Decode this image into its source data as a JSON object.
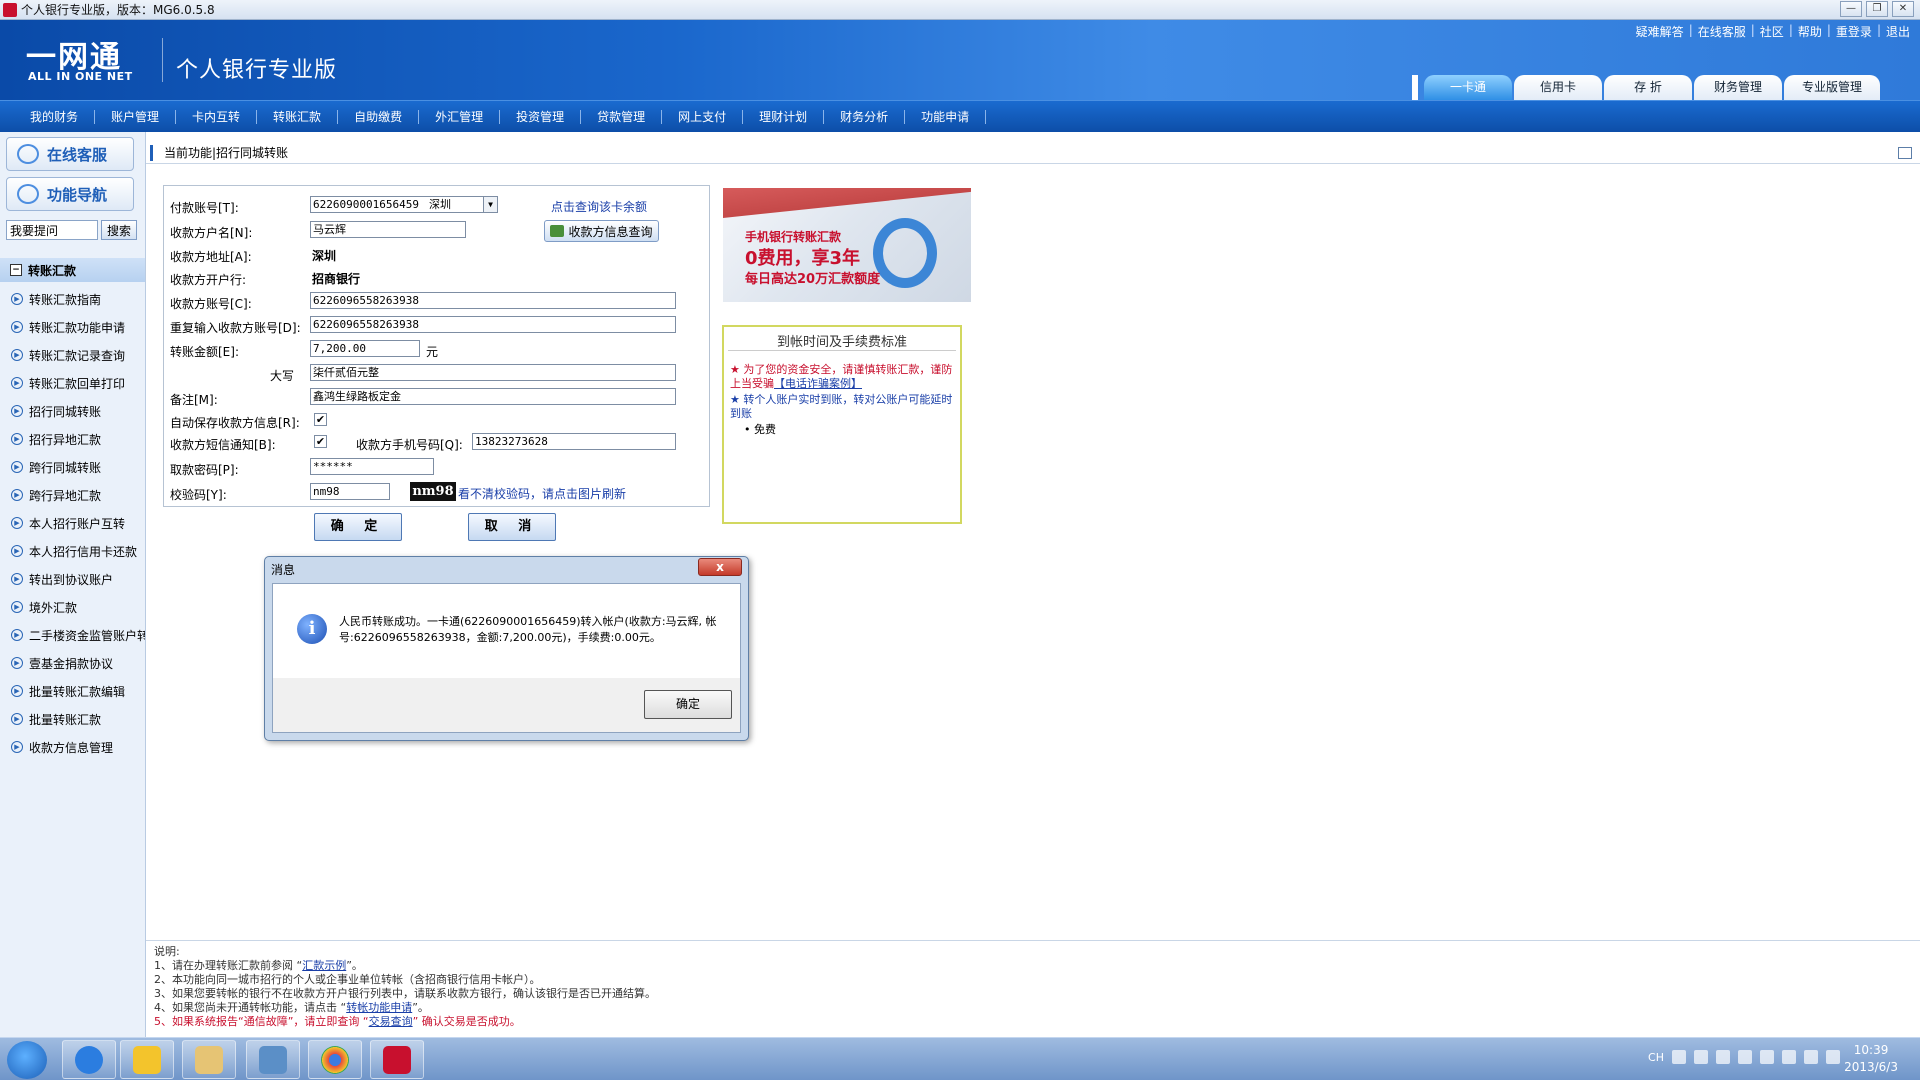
{
  "window": {
    "title": "个人银行专业版，版本：MG6.0.5.8",
    "controls": [
      "—",
      "❐",
      "✕"
    ]
  },
  "header": {
    "logo_main": "一网通",
    "logo_sub": "ALL IN ONE NET",
    "product_name": "个人银行专业版",
    "top_links": [
      "疑难解答",
      "在线客服",
      "社区",
      "帮助",
      "重登录",
      "退出"
    ],
    "tabs": [
      {
        "label": "一卡通",
        "active": true
      },
      {
        "label": "信用卡",
        "active": false
      },
      {
        "label": "存 折",
        "active": false
      },
      {
        "label": "财务管理",
        "active": false
      },
      {
        "label": "专业版管理",
        "active": false
      }
    ]
  },
  "nav": [
    "我的财务",
    "账户管理",
    "卡内互转",
    "转账汇款",
    "自助缴费",
    "外汇管理",
    "投资管理",
    "贷款管理",
    "网上支付",
    "理财计划",
    "财务分析",
    "功能申请"
  ],
  "sidebar": {
    "online_service": "在线客服",
    "function_nav": "功能导航",
    "search_placeholder": "我要提问",
    "search_button": "搜索",
    "section_title": "转账汇款",
    "items": [
      "转账汇款指南",
      "转账汇款功能申请",
      "转账汇款记录查询",
      "转账汇款回单打印",
      "招行同城转账",
      "招行异地汇款",
      "跨行同城转账",
      "跨行异地汇款",
      "本人招行账户互转",
      "本人招行信用卡还款",
      "转出到协议账户",
      "境外汇款",
      "二手楼资金监管账户转",
      "壹基金捐款协议",
      "批量转账汇款编辑",
      "批量转账汇款",
      "收款方信息管理"
    ]
  },
  "content": {
    "breadcrumb": "当前功能|招行同城转账",
    "form": {
      "payer_account_label": "付款账号[T]:",
      "payer_account_value": "6226090001656459",
      "payer_city": "深圳",
      "balance_link": "点击查询该卡余额",
      "payee_name_label": "收款方户名[N]:",
      "payee_name_value": "马云辉",
      "payee_info_button": "收款方信息查询",
      "payee_address_label": "收款方地址[A]:",
      "payee_address_value": "深圳",
      "payee_bank_label": "收款方开户行:",
      "payee_bank_value": "招商银行",
      "payee_account_label": "收款方账号[C]:",
      "payee_account_value": "6226096558263938",
      "payee_account_repeat_label": "重复输入收款方账号[D]:",
      "payee_account_repeat_value": "6226096558263938",
      "amount_label": "转账金额[E]:",
      "amount_value": "7,200.00",
      "amount_unit": "元",
      "uppercase_label": "大写",
      "uppercase_value": "柒仟贰佰元整",
      "remark_label": "备注[M]:",
      "remark_value": "鑫鸿生绿路板定金",
      "auto_save_label": "自动保存收款方信息[R]:",
      "auto_save_checked": "✔",
      "sms_label": "收款方短信通知[B]:",
      "sms_checked": "✔",
      "mobile_label": "收款方手机号码[Q]:",
      "mobile_value": "13823273628",
      "withdraw_pwd_label": "取款密码[P]:",
      "withdraw_pwd_value": "******",
      "captcha_label": "校验码[Y]:",
      "captcha_input": "nm98",
      "captcha_image_text": "nm98",
      "captcha_hint": "看不清校验码，请点击图片刷新",
      "confirm_button": "确 定",
      "cancel_button": "取 消"
    },
    "banner": {
      "line1": "手机银行转账汇款",
      "line2": "0费用，享3年",
      "line3": "每日高达20万汇款额度"
    },
    "notice": {
      "title": "到帐时间及手续费标准",
      "line1_star": "★",
      "line1": "为了您的资金安全，请谨慎转账汇款，谨防上当受骗",
      "line1_link": "【电话诈骗案例】",
      "line2_star": "★",
      "line2": "转个人账户实时到账，转对公账户可能延时到账",
      "line3": "免费"
    },
    "instructions": {
      "title": "说明:",
      "l1_a": "1、请在办理转账汇款前参阅 “",
      "l1_link": "汇款示例",
      "l1_b": "”。",
      "l2": "2、本功能向同一城市招行的个人或企事业单位转帐（含招商银行信用卡帐户）。",
      "l3": "3、如果您要转帐的银行不在收款方开户银行列表中，请联系收款方银行，确认该银行是否已开通结算。",
      "l4_a": "4、如果您尚未开通转帐功能，请点击 “",
      "l4_link": "转帐功能申请",
      "l4_b": "”。",
      "l5_a": "5、如果系统报告“通信故障”，请立即查询 “",
      "l5_link": "交易查询",
      "l5_b": "” 确认交易是否成功。"
    }
  },
  "modal": {
    "title": "消息",
    "message": "人民币转账成功。一卡通(6226090001656459)转入帐户(收款方:马云辉, 帐号:6226096558263938，金额:7,200.00元)，手续费:0.00元。",
    "ok_button": "确定",
    "close_label": "x"
  },
  "taskbar": {
    "ime": "CH",
    "clock_time": "10:39",
    "clock_date": "2013/6/3"
  },
  "colors": {
    "header_blue": "#1a67cc",
    "nav_blue": "#0d4ea8",
    "brand_red": "#c8102e",
    "notice_border": "#d2d860"
  }
}
